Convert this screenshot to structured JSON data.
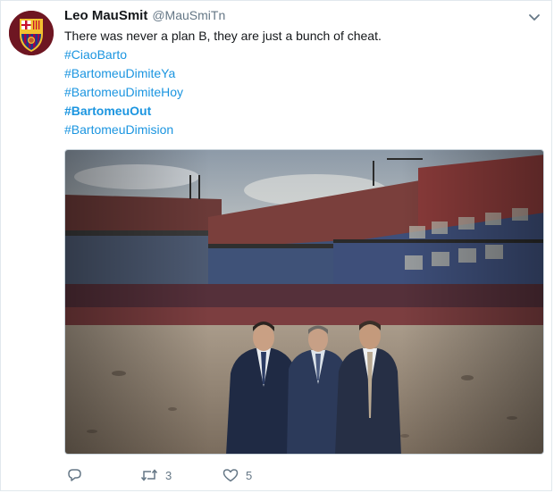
{
  "tweet": {
    "author_name": "Leo MauSmit",
    "author_handle": "@MauSmiTn",
    "text": "There was never a plan B, they are just a bunch of cheat.",
    "hashtags": [
      {
        "text": "#CiaoBarto",
        "bold": false
      },
      {
        "text": "#BartomeuDimiteYa",
        "bold": false
      },
      {
        "text": "#BartomeuDimiteHoy",
        "bold": false
      },
      {
        "text": "#BartomeuOut",
        "bold": true
      },
      {
        "text": "#BartomeuDimision",
        "bold": false
      }
    ],
    "retweet_count": "3",
    "like_count": "5"
  },
  "icons": {
    "avatar": "fc-barcelona-crest",
    "menu": "chevron-down-icon",
    "reply": "reply-icon",
    "retweet": "retweet-icon",
    "like": "heart-icon"
  },
  "colors": {
    "link": "#1b95e0",
    "muted": "#657786",
    "text": "#14171a",
    "barca_blue": "#1a3a8a",
    "barca_red": "#a50044"
  }
}
